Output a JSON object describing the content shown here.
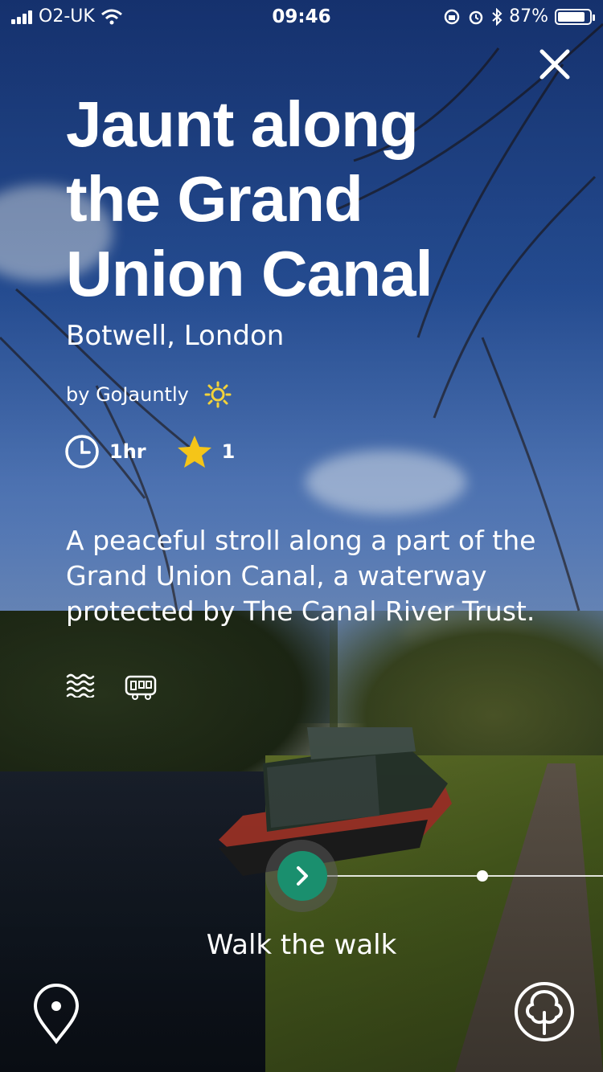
{
  "status_bar": {
    "carrier": "O2-UK",
    "time": "09:46",
    "battery_percent": "87%",
    "battery_level": 0.87
  },
  "walk": {
    "title": "Jaunt along the Grand Union Canal",
    "location": "Botwell, London",
    "author": "by GoJauntly",
    "duration": "1hr",
    "rating": "1",
    "description": "A peaceful stroll along a part of the Grand Union Canal, a waterway protected by The Canal River Trust.",
    "tags": [
      "water-icon",
      "caravan-icon"
    ]
  },
  "actions": {
    "cta_label": "Walk the walk",
    "map_icon": "location-pin-icon",
    "tree_icon": "tree-icon",
    "close_icon": "close-icon"
  },
  "colors": {
    "accent": "#1a8f6e",
    "star": "#f5c518",
    "sun": "#f2d23a"
  }
}
